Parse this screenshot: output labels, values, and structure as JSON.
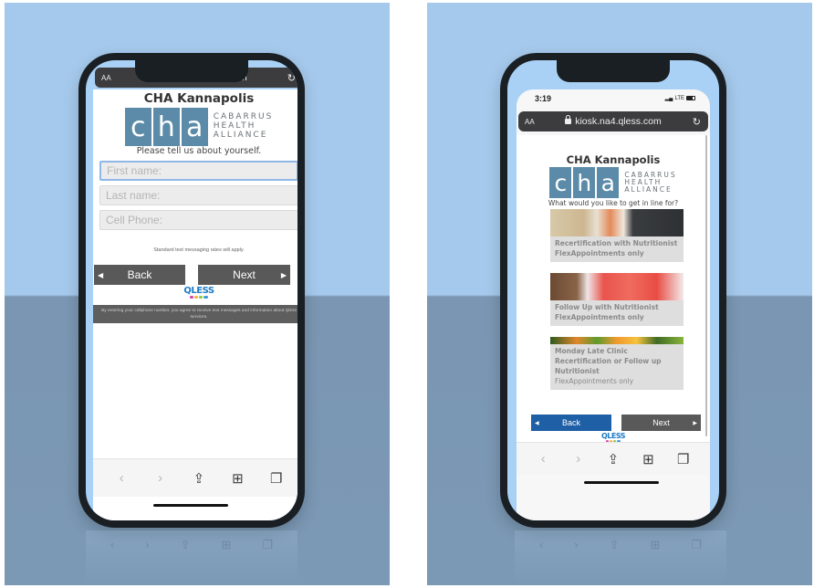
{
  "browser": {
    "url": "kiosk.na4.qless.com",
    "text_size_label": "AA",
    "reload_icon": "reload-icon"
  },
  "left_screen": {
    "title": "CHA Kannapolis",
    "logo": {
      "letters": [
        "c",
        "h",
        "a"
      ],
      "words": [
        "CABARRUS",
        "HEALTH",
        "ALLIANCE"
      ]
    },
    "prompt": "Please tell us about yourself.",
    "fields": [
      {
        "name": "first-name",
        "placeholder": "First name:",
        "value": "",
        "focused": true
      },
      {
        "name": "last-name",
        "placeholder": "Last name:",
        "value": "",
        "focused": false
      },
      {
        "name": "cell-phone",
        "placeholder": "Cell Phone:",
        "value": "",
        "focused": false
      }
    ],
    "rates_note": "Standard text messaging rates will apply.",
    "back_label": "Back",
    "next_label": "Next",
    "qless_brand": "QLESS",
    "consent": "By entering your cellphone number, you agree to receive text messages and information about Qless services."
  },
  "right_screen": {
    "status_time": "3:19",
    "network": "LTE",
    "title": "CHA Kannapolis",
    "logo": {
      "letters": [
        "c",
        "h",
        "a"
      ],
      "words": [
        "CABARRUS",
        "HEALTH",
        "ALLIANCE"
      ]
    },
    "prompt": "What would you like to get in line for?",
    "services": [
      {
        "lines": [
          "Recertification with Nutritionist"
        ],
        "note": "FlexAppointments only",
        "note_bold": true,
        "image": "oatmeal-bowl"
      },
      {
        "lines": [
          "Follow Up with Nutritionist"
        ],
        "note": "FlexAppointments only",
        "note_bold": true,
        "image": "strawberries"
      },
      {
        "lines": [
          "Monday Late Clinic",
          "Recertification or Follow up",
          "Nutritionist"
        ],
        "note": "FlexAppointments only",
        "note_bold": false,
        "image": "vegetables"
      }
    ],
    "back_label": "Back",
    "next_label": "Next",
    "qless_brand": "QLESS"
  },
  "toolbar": {
    "icons": [
      "back-icon",
      "forward-icon",
      "share-icon",
      "bookmarks-icon",
      "tabs-icon"
    ]
  },
  "colors": {
    "logo_blue": "#5b8ba8",
    "button_gray": "#595959",
    "button_blue": "#1f5fa6",
    "qless_blue": "#1e7bc4",
    "backdrop_sky": "#a5c9ec",
    "backdrop_floor": "#7a96b2"
  }
}
